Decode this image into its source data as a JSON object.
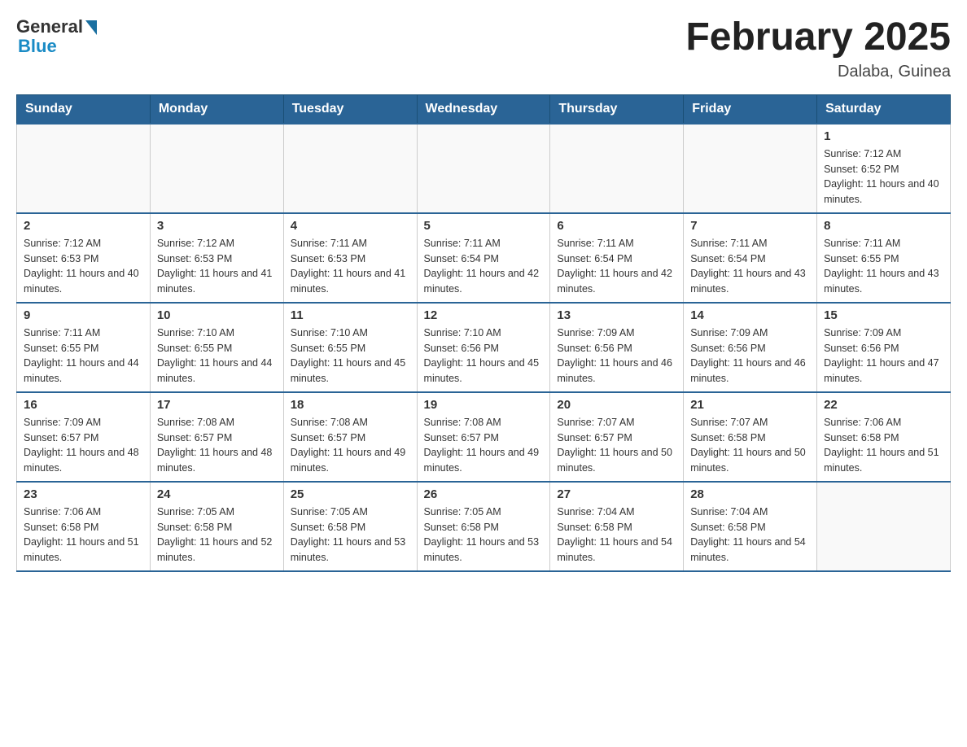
{
  "header": {
    "logo_general": "General",
    "logo_blue": "Blue",
    "month_title": "February 2025",
    "location": "Dalaba, Guinea"
  },
  "days_of_week": [
    "Sunday",
    "Monday",
    "Tuesday",
    "Wednesday",
    "Thursday",
    "Friday",
    "Saturday"
  ],
  "weeks": [
    [
      {
        "day": "",
        "info": ""
      },
      {
        "day": "",
        "info": ""
      },
      {
        "day": "",
        "info": ""
      },
      {
        "day": "",
        "info": ""
      },
      {
        "day": "",
        "info": ""
      },
      {
        "day": "",
        "info": ""
      },
      {
        "day": "1",
        "info": "Sunrise: 7:12 AM\nSunset: 6:52 PM\nDaylight: 11 hours and 40 minutes."
      }
    ],
    [
      {
        "day": "2",
        "info": "Sunrise: 7:12 AM\nSunset: 6:53 PM\nDaylight: 11 hours and 40 minutes."
      },
      {
        "day": "3",
        "info": "Sunrise: 7:12 AM\nSunset: 6:53 PM\nDaylight: 11 hours and 41 minutes."
      },
      {
        "day": "4",
        "info": "Sunrise: 7:11 AM\nSunset: 6:53 PM\nDaylight: 11 hours and 41 minutes."
      },
      {
        "day": "5",
        "info": "Sunrise: 7:11 AM\nSunset: 6:54 PM\nDaylight: 11 hours and 42 minutes."
      },
      {
        "day": "6",
        "info": "Sunrise: 7:11 AM\nSunset: 6:54 PM\nDaylight: 11 hours and 42 minutes."
      },
      {
        "day": "7",
        "info": "Sunrise: 7:11 AM\nSunset: 6:54 PM\nDaylight: 11 hours and 43 minutes."
      },
      {
        "day": "8",
        "info": "Sunrise: 7:11 AM\nSunset: 6:55 PM\nDaylight: 11 hours and 43 minutes."
      }
    ],
    [
      {
        "day": "9",
        "info": "Sunrise: 7:11 AM\nSunset: 6:55 PM\nDaylight: 11 hours and 44 minutes."
      },
      {
        "day": "10",
        "info": "Sunrise: 7:10 AM\nSunset: 6:55 PM\nDaylight: 11 hours and 44 minutes."
      },
      {
        "day": "11",
        "info": "Sunrise: 7:10 AM\nSunset: 6:55 PM\nDaylight: 11 hours and 45 minutes."
      },
      {
        "day": "12",
        "info": "Sunrise: 7:10 AM\nSunset: 6:56 PM\nDaylight: 11 hours and 45 minutes."
      },
      {
        "day": "13",
        "info": "Sunrise: 7:09 AM\nSunset: 6:56 PM\nDaylight: 11 hours and 46 minutes."
      },
      {
        "day": "14",
        "info": "Sunrise: 7:09 AM\nSunset: 6:56 PM\nDaylight: 11 hours and 46 minutes."
      },
      {
        "day": "15",
        "info": "Sunrise: 7:09 AM\nSunset: 6:56 PM\nDaylight: 11 hours and 47 minutes."
      }
    ],
    [
      {
        "day": "16",
        "info": "Sunrise: 7:09 AM\nSunset: 6:57 PM\nDaylight: 11 hours and 48 minutes."
      },
      {
        "day": "17",
        "info": "Sunrise: 7:08 AM\nSunset: 6:57 PM\nDaylight: 11 hours and 48 minutes."
      },
      {
        "day": "18",
        "info": "Sunrise: 7:08 AM\nSunset: 6:57 PM\nDaylight: 11 hours and 49 minutes."
      },
      {
        "day": "19",
        "info": "Sunrise: 7:08 AM\nSunset: 6:57 PM\nDaylight: 11 hours and 49 minutes."
      },
      {
        "day": "20",
        "info": "Sunrise: 7:07 AM\nSunset: 6:57 PM\nDaylight: 11 hours and 50 minutes."
      },
      {
        "day": "21",
        "info": "Sunrise: 7:07 AM\nSunset: 6:58 PM\nDaylight: 11 hours and 50 minutes."
      },
      {
        "day": "22",
        "info": "Sunrise: 7:06 AM\nSunset: 6:58 PM\nDaylight: 11 hours and 51 minutes."
      }
    ],
    [
      {
        "day": "23",
        "info": "Sunrise: 7:06 AM\nSunset: 6:58 PM\nDaylight: 11 hours and 51 minutes."
      },
      {
        "day": "24",
        "info": "Sunrise: 7:05 AM\nSunset: 6:58 PM\nDaylight: 11 hours and 52 minutes."
      },
      {
        "day": "25",
        "info": "Sunrise: 7:05 AM\nSunset: 6:58 PM\nDaylight: 11 hours and 53 minutes."
      },
      {
        "day": "26",
        "info": "Sunrise: 7:05 AM\nSunset: 6:58 PM\nDaylight: 11 hours and 53 minutes."
      },
      {
        "day": "27",
        "info": "Sunrise: 7:04 AM\nSunset: 6:58 PM\nDaylight: 11 hours and 54 minutes."
      },
      {
        "day": "28",
        "info": "Sunrise: 7:04 AM\nSunset: 6:58 PM\nDaylight: 11 hours and 54 minutes."
      },
      {
        "day": "",
        "info": ""
      }
    ]
  ]
}
